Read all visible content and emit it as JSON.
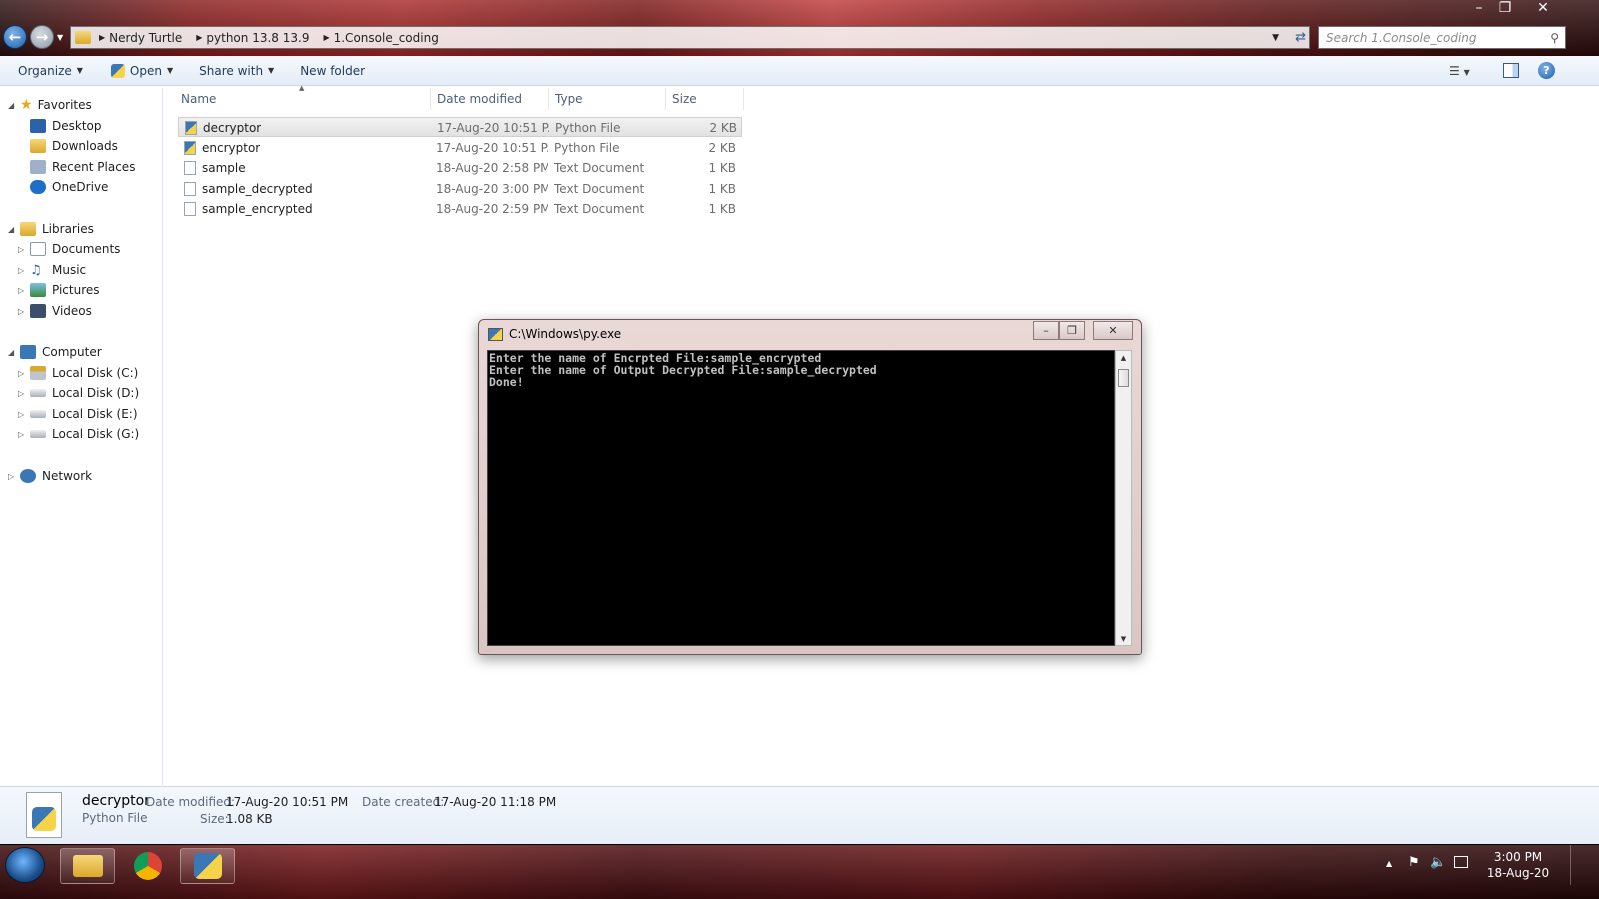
{
  "explorer": {
    "breadcrumb": [
      "Nerdy Turtle",
      "python 13.8 13.9",
      "1.Console_coding"
    ],
    "search_placeholder": "Search 1.Console_coding",
    "toolbar": {
      "organize": "Organize",
      "open": "Open",
      "share_with": "Share with",
      "new_folder": "New folder"
    },
    "nav": {
      "favorites": "Favorites",
      "desktop": "Desktop",
      "downloads": "Downloads",
      "recent_places": "Recent Places",
      "onedrive": "OneDrive",
      "libraries": "Libraries",
      "documents": "Documents",
      "music": "Music",
      "pictures": "Pictures",
      "videos": "Videos",
      "computer": "Computer",
      "disk_c": "Local Disk (C:)",
      "disk_d": "Local Disk (D:)",
      "disk_e": "Local Disk (E:)",
      "disk_g": "Local Disk (G:)",
      "network": "Network"
    },
    "columns": {
      "name": "Name",
      "date": "Date modified",
      "type": "Type",
      "size": "Size"
    },
    "files": [
      {
        "name": "decryptor",
        "date": "17-Aug-20 10:51 P...",
        "type": "Python File",
        "size": "2 KB"
      },
      {
        "name": "encryptor",
        "date": "17-Aug-20 10:51 P...",
        "type": "Python File",
        "size": "2 KB"
      },
      {
        "name": "sample",
        "date": "18-Aug-20 2:58 PM",
        "type": "Text Document",
        "size": "1 KB"
      },
      {
        "name": "sample_decrypted",
        "date": "18-Aug-20 3:00 PM",
        "type": "Text Document",
        "size": "1 KB"
      },
      {
        "name": "sample_encrypted",
        "date": "18-Aug-20 2:59 PM",
        "type": "Text Document",
        "size": "1 KB"
      }
    ],
    "details": {
      "name": "decryptor",
      "type": "Python File",
      "date_modified_label": "Date modified:",
      "date_modified": "17-Aug-20 10:51 PM",
      "size_label": "Size:",
      "size": "1.08 KB",
      "date_created_label": "Date created:",
      "date_created": "17-Aug-20 11:18 PM"
    }
  },
  "console": {
    "title": "C:\\Windows\\py.exe",
    "lines": [
      "Enter the name of Encrpted File:sample_encrypted",
      "Enter the name of Output Decrypted File:sample_decrypted",
      "Done!"
    ]
  },
  "taskbar": {
    "time": "3:00 PM",
    "date": "18-Aug-20"
  }
}
